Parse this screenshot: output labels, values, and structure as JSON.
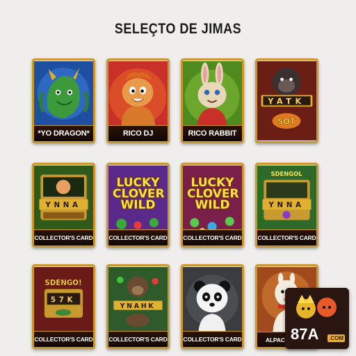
{
  "page": {
    "title": "SELEÇTO DE JIMAS"
  },
  "cards": [
    {
      "label": "*YO DRAGON*",
      "theme": "dragon",
      "bg": "#1f4fa0"
    },
    {
      "label": "RICO DJ",
      "theme": "hamster",
      "bg": "#c8302a"
    },
    {
      "label": "RICO RABBIT",
      "theme": "rabbit",
      "bg": "#4e8a1e"
    },
    {
      "label": "COLLECTOR'S CARD",
      "theme": "gorilla-slot",
      "bg": "#6b1e14",
      "reel_text": "YATK",
      "sign_text": "SOT"
    },
    {
      "label": "COLLECTOR'S CARD",
      "theme": "slot",
      "bg": "#2f5a1a",
      "reel_text": "YNNA"
    },
    {
      "label": "COLLECTOR'S CARD",
      "theme": "lucky-clover",
      "bg": "#5a2a8a",
      "big_text": "LUCKY CLOVER WILD"
    },
    {
      "label": "COLLECTOR'S CARD",
      "theme": "lucky-clover",
      "bg": "#7a1f4a",
      "big_text": "LUCKY CLOVER WILD"
    },
    {
      "label": "COLLECTOR'S CARD",
      "theme": "slot",
      "bg": "#2d6a2a",
      "reel_text": "YNNA",
      "sign_text": "SDENGOL"
    },
    {
      "label": "COLLECTOR'S CARD",
      "theme": "slot",
      "bg": "#6a1b18",
      "reel_text": "57K",
      "sign_text": "SDENGO!"
    },
    {
      "label": "COLLECTOR'S CARD",
      "theme": "gorilla",
      "bg": "#2f5a2a",
      "reel_text": "YNAHK"
    },
    {
      "label": "COLLECTOR'S CARD",
      "theme": "panda",
      "bg": "#3a3d40"
    },
    {
      "label": "ALPAC",
      "theme": "alpaca",
      "bg": "#a04a1e"
    }
  ],
  "badge": {
    "brand": "87A",
    "tag": ".COM"
  }
}
